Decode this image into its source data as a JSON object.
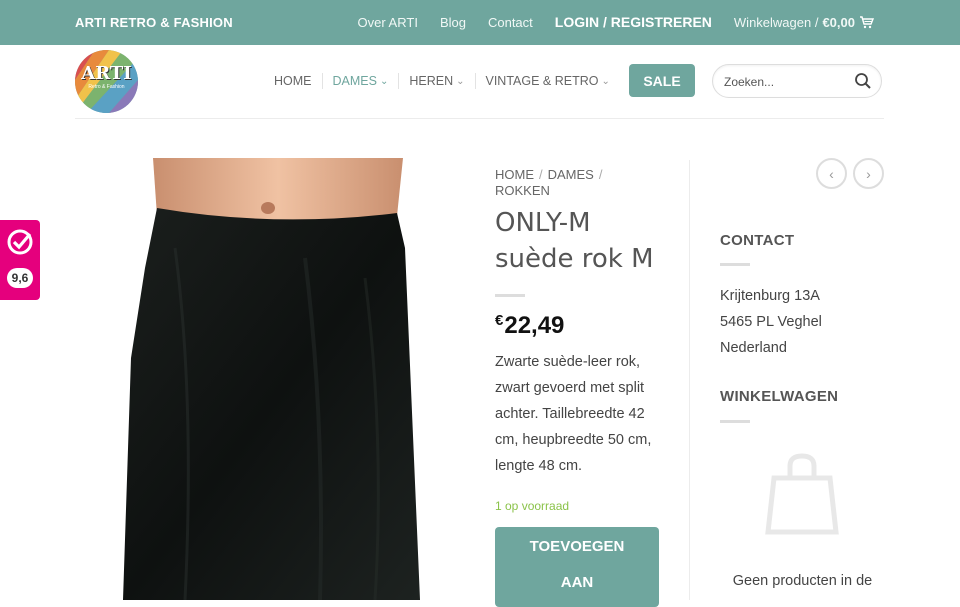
{
  "topbar": {
    "brand": "ARTI RETRO & FASHION",
    "links": [
      "Over ARTI",
      "Blog",
      "Contact"
    ],
    "login": "LOGIN / REGISTREREN",
    "cart_label": "Winkelwagen /",
    "cart_amount": "€0,00",
    "background": "#6fa69e"
  },
  "logo": {
    "text": "ARTI",
    "subtext": "Retro & Fashion"
  },
  "nav": {
    "items": [
      {
        "label": "HOME",
        "dropdown": false
      },
      {
        "label": "DAMES",
        "dropdown": true,
        "active": true
      },
      {
        "label": "HEREN",
        "dropdown": true
      },
      {
        "label": "VINTAGE & RETRO",
        "dropdown": true
      }
    ],
    "sale": "SALE",
    "search_placeholder": "Zoeken..."
  },
  "rating": {
    "score": "9,6",
    "color": "#e5007d"
  },
  "product": {
    "breadcrumb": [
      "HOME",
      "DAMES",
      "ROKKEN"
    ],
    "title_line1": "ONLY-M",
    "title_line2": "suède rok M",
    "currency": "€",
    "price": "22,49",
    "description": "Zwarte suède-leer rok, zwart gevoerd met split achter. Taillebreedte 42 cm, heupbreedte 50 cm, lengte 48 cm.",
    "stock": "1 op voorraad",
    "add_button_line1": "TOEVOEGEN",
    "add_button_line2": "AAN"
  },
  "sidebar": {
    "contact_heading": "CONTACT",
    "address": [
      "Krijtenburg 13A",
      "5465 PL Veghel",
      "Nederland"
    ],
    "cart_heading": "WINKELWAGEN",
    "empty_text": "Geen producten in de"
  },
  "icons": [
    "cart-icon",
    "chevron-down-icon",
    "search-icon",
    "check-icon",
    "chevron-left-icon",
    "chevron-right-icon",
    "shopping-bag-icon"
  ]
}
